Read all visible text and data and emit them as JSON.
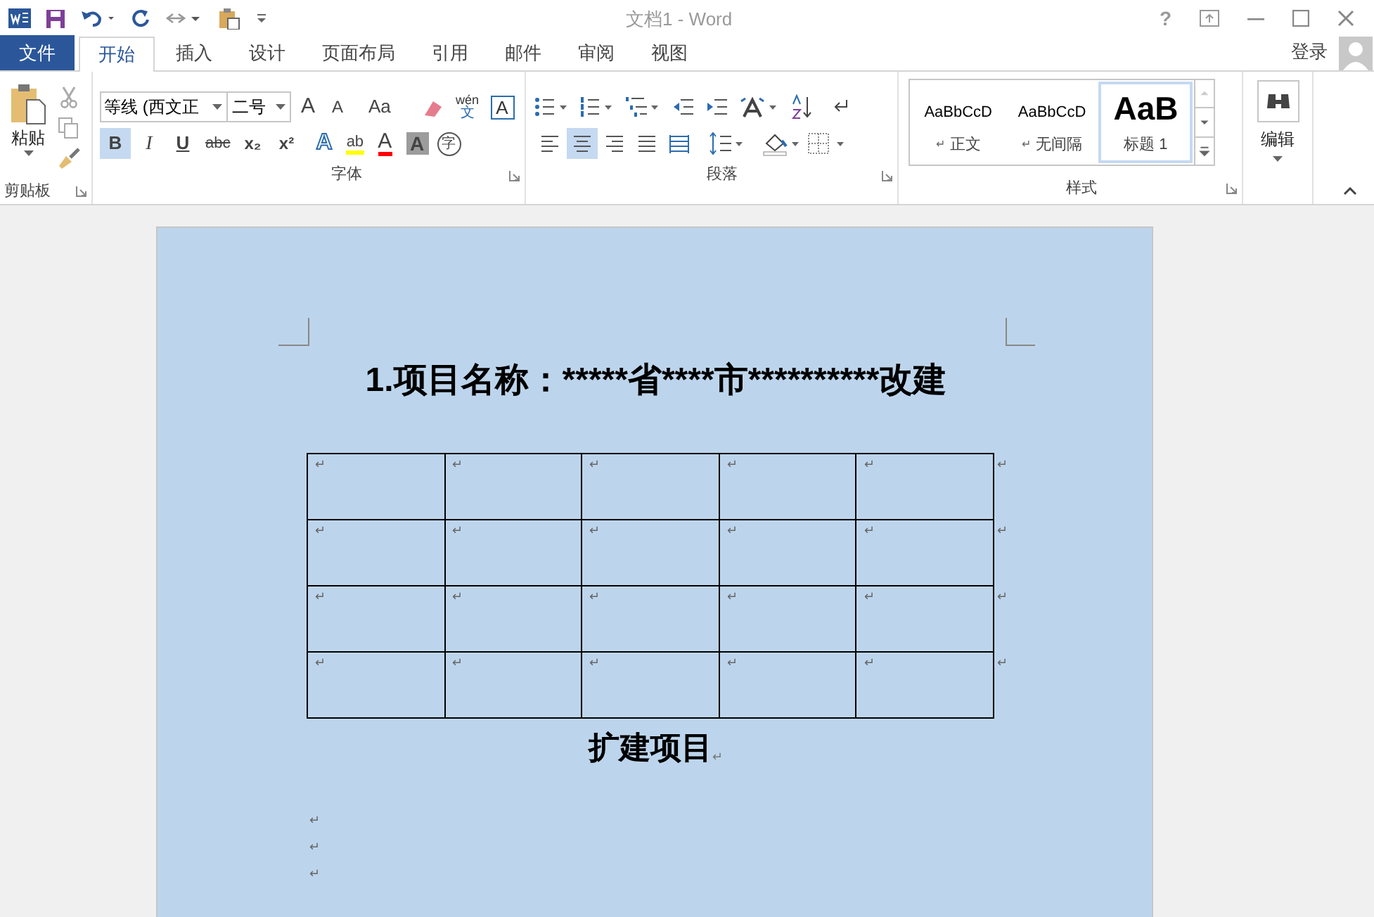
{
  "title_bar": {
    "title": "文档1 - Word",
    "help": "?"
  },
  "tabs": [
    {
      "label": "文件",
      "kind": "file",
      "selected": false
    },
    {
      "label": "开始",
      "kind": "tab",
      "selected": true
    },
    {
      "label": "插入",
      "kind": "tab",
      "selected": false
    },
    {
      "label": "设计",
      "kind": "tab",
      "selected": false
    },
    {
      "label": "页面布局",
      "kind": "tab",
      "selected": false
    },
    {
      "label": "引用",
      "kind": "tab",
      "selected": false
    },
    {
      "label": "邮件",
      "kind": "tab",
      "selected": false
    },
    {
      "label": "审阅",
      "kind": "tab",
      "selected": false
    },
    {
      "label": "视图",
      "kind": "tab",
      "selected": false
    }
  ],
  "account": {
    "sign_in": "登录"
  },
  "clipboard": {
    "paste": "粘贴",
    "group": "剪贴板"
  },
  "font": {
    "font_name": "等线 (西文正",
    "font_size": "二号",
    "grow": "A",
    "shrink": "A",
    "change_case": "Aa",
    "phonetic_top": "wén",
    "phonetic_bottom": "文",
    "border_char": "A",
    "format_buttons": [
      {
        "label": "B",
        "kind": "bold",
        "selected": true
      },
      {
        "label": "I",
        "kind": "italic",
        "selected": false
      },
      {
        "label": "U",
        "kind": "underline",
        "selected": false
      },
      {
        "label": "abc",
        "kind": "strike",
        "selected": false
      },
      {
        "label": "x₂",
        "kind": "sub",
        "selected": false
      },
      {
        "label": "x²",
        "kind": "sup",
        "selected": false
      }
    ],
    "effects": "A",
    "highlight": "ab",
    "font_color": "A",
    "shading": "A",
    "enclose": "字",
    "group": "字体"
  },
  "paragraph": {
    "align": [
      {
        "kind": "left",
        "selected": false
      },
      {
        "kind": "center",
        "selected": true
      },
      {
        "kind": "right",
        "selected": false
      },
      {
        "kind": "justify",
        "selected": false
      },
      {
        "kind": "distributed",
        "selected": false
      }
    ],
    "group": "段落"
  },
  "styles": {
    "items": [
      {
        "preview": "AaBbCcD",
        "mark": "↵",
        "name": "正文",
        "kind": "normal",
        "selected": false
      },
      {
        "preview": "AaBbCcD",
        "mark": "↵",
        "name": "无间隔",
        "kind": "normal",
        "selected": false
      },
      {
        "preview": "AaB",
        "name": "标题 1",
        "kind": "heading",
        "selected": true
      }
    ],
    "group": "样式"
  },
  "editing": {
    "label": "编辑"
  },
  "document": {
    "heading": "1.项目名称：*****省****市**********改建",
    "table": {
      "rows": [
        {
          "cells": [
            "↵",
            "↵",
            "↵",
            "↵",
            "↵"
          ],
          "row_end": "↵"
        },
        {
          "cells": [
            "↵",
            "↵",
            "↵",
            "↵",
            "↵"
          ],
          "row_end": "↵"
        },
        {
          "cells": [
            "↵",
            "↵",
            "↵",
            "↵",
            "↵"
          ],
          "row_end": "↵"
        },
        {
          "cells": [
            "↵",
            "↵",
            "↵",
            "↵",
            "↵"
          ],
          "row_end": "↵"
        }
      ]
    },
    "caption": "扩建项目",
    "caption_mark": "↵",
    "empty_paragraphs": [
      "↵",
      "↵",
      "↵"
    ]
  }
}
